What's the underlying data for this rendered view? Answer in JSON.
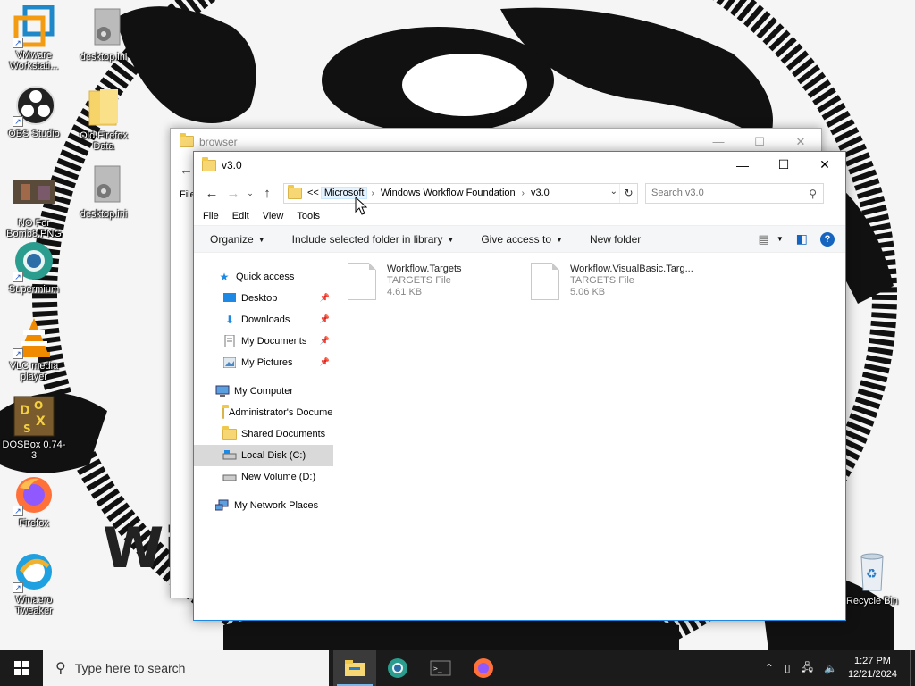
{
  "desktop": {
    "icons": [
      {
        "label": "VMware Workstati...",
        "icon": "vmware-icon"
      },
      {
        "label": "desktop.ini",
        "icon": "settings-file-icon"
      },
      {
        "label": "OBS Studio",
        "icon": "obs-icon"
      },
      {
        "label": "Old Firefox Data",
        "icon": "folder-icon"
      },
      {
        "label": "NO For Bomb8.PNG",
        "icon": "image-icon"
      },
      {
        "label": "desktop.ini",
        "icon": "settings-file-icon"
      },
      {
        "label": "Supermium",
        "icon": "supermium-icon"
      },
      {
        "label": "VLC media player",
        "icon": "vlc-icon"
      },
      {
        "label": "DOSBox 0.74-3",
        "icon": "dosbox-icon"
      },
      {
        "label": "Firefox",
        "icon": "firefox-icon"
      },
      {
        "label": "Winaero Tweaker",
        "icon": "winaero-icon"
      },
      {
        "label": "Recycle Bin",
        "icon": "recycle-bin-icon"
      }
    ]
  },
  "back_window": {
    "title": "browser",
    "partial_menu": "File"
  },
  "explorer": {
    "title": "v3.0",
    "address": {
      "overflow": "<<",
      "crumbs": [
        "Microsoft",
        "Windows Workflow Foundation",
        "v3.0"
      ]
    },
    "search_placeholder": "Search v3.0",
    "menu": [
      "File",
      "Edit",
      "View",
      "Tools"
    ],
    "commands": {
      "organize": "Organize",
      "include": "Include selected folder in library",
      "give_access": "Give access to",
      "new_folder": "New folder"
    },
    "nav": {
      "quick_access": "Quick access",
      "desktop": "Desktop",
      "downloads": "Downloads",
      "my_documents": "My Documents",
      "my_pictures": "My Pictures",
      "my_computer": "My Computer",
      "admin_docs": "Administrator's Documents",
      "shared_docs": "Shared Documents",
      "local_disk": "Local Disk (C:)",
      "new_volume": "New Volume (D:)",
      "network": "My Network Places"
    },
    "files": [
      {
        "name": "Workflow.Targets",
        "type": "TARGETS File",
        "size": "4.61 KB"
      },
      {
        "name": "Workflow.VisualBasic.Targ...",
        "type": "TARGETS File",
        "size": "5.06 KB"
      }
    ]
  },
  "taskbar": {
    "search_placeholder": "Type here to search",
    "time": "1:27 PM",
    "date": "12/21/2024"
  },
  "colors": {
    "accent": "#1e88e5",
    "taskbar": "#1b1b1b",
    "folder": "#f7d774"
  }
}
